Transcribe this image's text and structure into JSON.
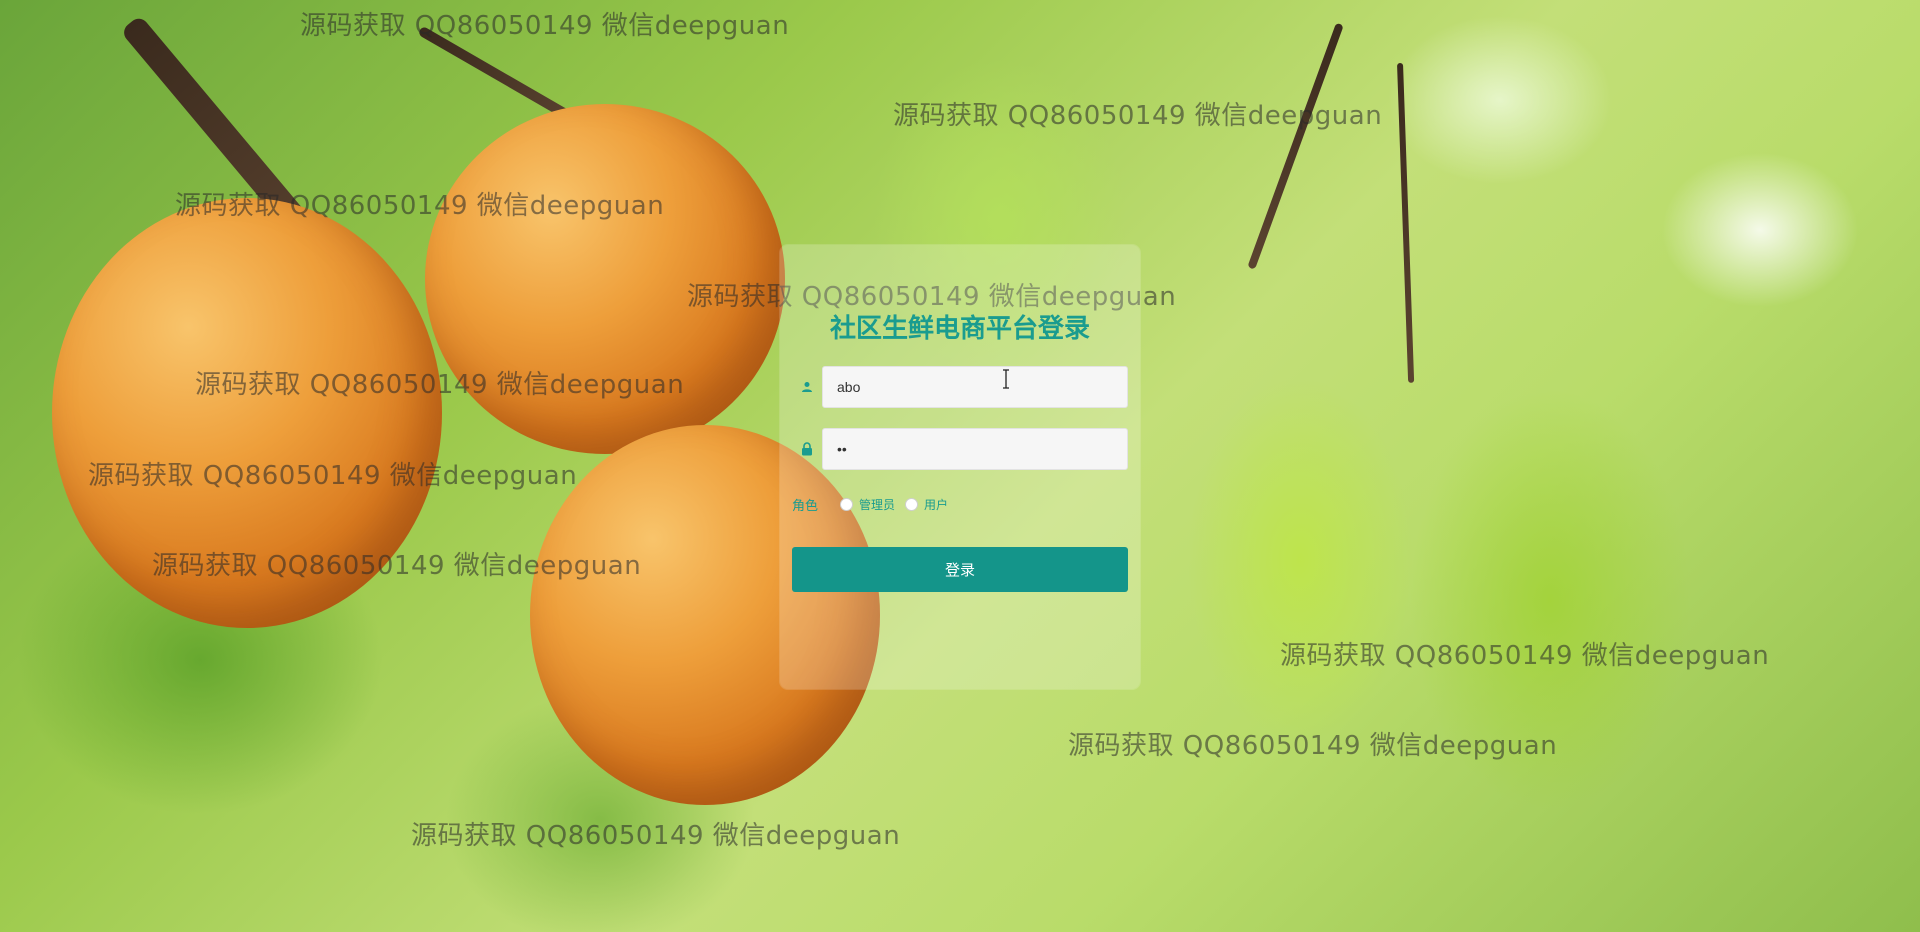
{
  "login": {
    "title": "社区生鲜电商平台登录",
    "username_value": "abo",
    "password_value": "••",
    "role_label": "角色",
    "roles": [
      {
        "label": "管理员",
        "selected": false
      },
      {
        "label": "用户",
        "selected": false
      }
    ],
    "submit_label": "登录"
  },
  "watermark": {
    "text": "源码获取 QQ86050149 微信deepguan"
  },
  "icons": {
    "username": "user-icon",
    "password": "lock-icon"
  },
  "colors": {
    "accent": "#1a9c8f",
    "button": "#14958a"
  }
}
